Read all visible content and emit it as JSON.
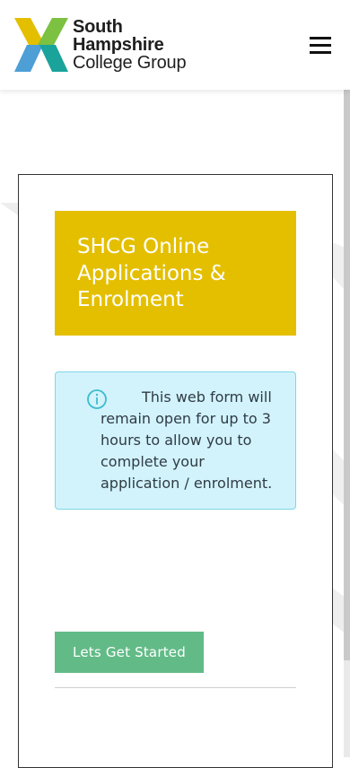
{
  "header": {
    "logo": {
      "line1": "South",
      "line2": "Hampshire",
      "line3": "College Group",
      "colors": {
        "yellow": "#e4bf00",
        "green": "#7cc142",
        "blue": "#4d9fd6",
        "teal": "#1aa39a",
        "text": "#1e1e1e"
      }
    },
    "menu_icon": "hamburger-menu-icon"
  },
  "main": {
    "title": "SHCG Online Applications & Enrolment",
    "info": {
      "icon": "info-circle-icon",
      "text": "This web form will remain open for up to 3 hours to allow you to complete your application / enrolment."
    },
    "start_button": "Lets Get Started"
  },
  "colors": {
    "title_bg": "#e4bf00",
    "info_bg": "#d2f3fb",
    "info_border": "#7fd6e8",
    "button_bg": "#62bb87"
  }
}
